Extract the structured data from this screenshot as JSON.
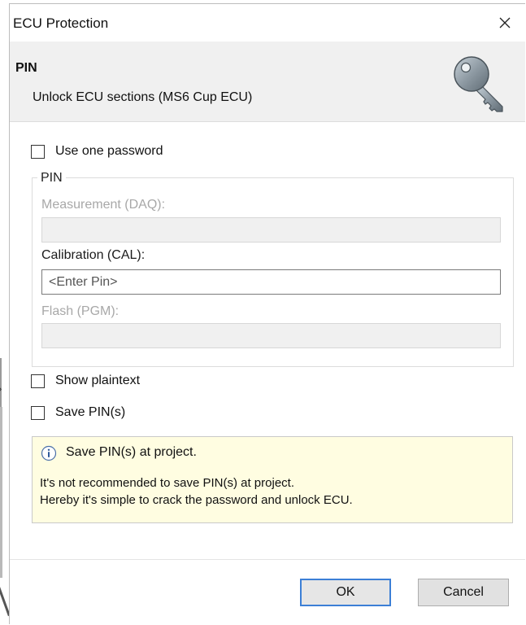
{
  "window": {
    "title": "ECU Protection"
  },
  "header": {
    "title": "PIN",
    "subtitle": "Unlock ECU sections (MS6 Cup ECU)",
    "icon": "key-icon"
  },
  "options": {
    "use_one_password": {
      "label": "Use one password",
      "checked": false
    },
    "show_plaintext": {
      "label": "Show plaintext",
      "checked": false
    },
    "save_pins": {
      "label": "Save PIN(s)",
      "checked": false
    }
  },
  "pin_group": {
    "legend": "PIN",
    "measurement": {
      "label": "Measurement (DAQ):",
      "value": "",
      "enabled": false
    },
    "calibration": {
      "label": "Calibration (CAL):",
      "placeholder": "<Enter Pin>",
      "value": "",
      "enabled": true
    },
    "flash": {
      "label": "Flash (PGM):",
      "value": "",
      "enabled": false
    }
  },
  "info": {
    "icon": "info-icon",
    "title": "Save PIN(s) at project.",
    "line1": "It's not recommended to save PIN(s) at project.",
    "line2": "Hereby it's simple to crack the password and unlock ECU."
  },
  "buttons": {
    "ok": "OK",
    "cancel": "Cancel"
  },
  "colors": {
    "info_bg": "#fffde1",
    "header_bg": "#f0f0f0",
    "ok_border": "#3c7fd6"
  }
}
